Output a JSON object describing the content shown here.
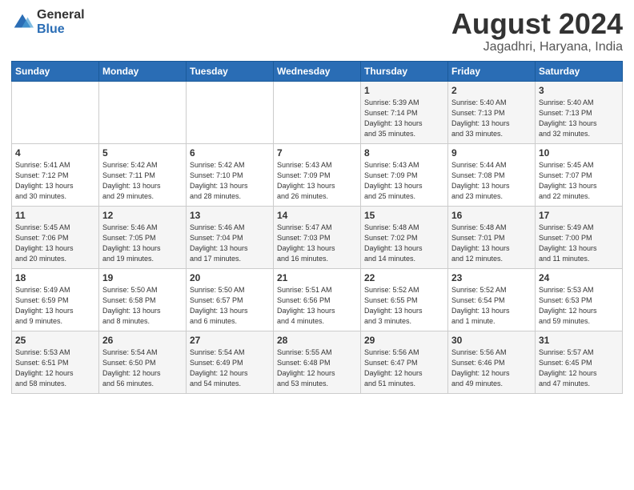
{
  "header": {
    "logo_general": "General",
    "logo_blue": "Blue",
    "month_year": "August 2024",
    "location": "Jagadhri, Haryana, India"
  },
  "days_of_week": [
    "Sunday",
    "Monday",
    "Tuesday",
    "Wednesday",
    "Thursday",
    "Friday",
    "Saturday"
  ],
  "weeks": [
    [
      {
        "day": "",
        "info": ""
      },
      {
        "day": "",
        "info": ""
      },
      {
        "day": "",
        "info": ""
      },
      {
        "day": "",
        "info": ""
      },
      {
        "day": "1",
        "info": "Sunrise: 5:39 AM\nSunset: 7:14 PM\nDaylight: 13 hours\nand 35 minutes."
      },
      {
        "day": "2",
        "info": "Sunrise: 5:40 AM\nSunset: 7:13 PM\nDaylight: 13 hours\nand 33 minutes."
      },
      {
        "day": "3",
        "info": "Sunrise: 5:40 AM\nSunset: 7:13 PM\nDaylight: 13 hours\nand 32 minutes."
      }
    ],
    [
      {
        "day": "4",
        "info": "Sunrise: 5:41 AM\nSunset: 7:12 PM\nDaylight: 13 hours\nand 30 minutes."
      },
      {
        "day": "5",
        "info": "Sunrise: 5:42 AM\nSunset: 7:11 PM\nDaylight: 13 hours\nand 29 minutes."
      },
      {
        "day": "6",
        "info": "Sunrise: 5:42 AM\nSunset: 7:10 PM\nDaylight: 13 hours\nand 28 minutes."
      },
      {
        "day": "7",
        "info": "Sunrise: 5:43 AM\nSunset: 7:09 PM\nDaylight: 13 hours\nand 26 minutes."
      },
      {
        "day": "8",
        "info": "Sunrise: 5:43 AM\nSunset: 7:09 PM\nDaylight: 13 hours\nand 25 minutes."
      },
      {
        "day": "9",
        "info": "Sunrise: 5:44 AM\nSunset: 7:08 PM\nDaylight: 13 hours\nand 23 minutes."
      },
      {
        "day": "10",
        "info": "Sunrise: 5:45 AM\nSunset: 7:07 PM\nDaylight: 13 hours\nand 22 minutes."
      }
    ],
    [
      {
        "day": "11",
        "info": "Sunrise: 5:45 AM\nSunset: 7:06 PM\nDaylight: 13 hours\nand 20 minutes."
      },
      {
        "day": "12",
        "info": "Sunrise: 5:46 AM\nSunset: 7:05 PM\nDaylight: 13 hours\nand 19 minutes."
      },
      {
        "day": "13",
        "info": "Sunrise: 5:46 AM\nSunset: 7:04 PM\nDaylight: 13 hours\nand 17 minutes."
      },
      {
        "day": "14",
        "info": "Sunrise: 5:47 AM\nSunset: 7:03 PM\nDaylight: 13 hours\nand 16 minutes."
      },
      {
        "day": "15",
        "info": "Sunrise: 5:48 AM\nSunset: 7:02 PM\nDaylight: 13 hours\nand 14 minutes."
      },
      {
        "day": "16",
        "info": "Sunrise: 5:48 AM\nSunset: 7:01 PM\nDaylight: 13 hours\nand 12 minutes."
      },
      {
        "day": "17",
        "info": "Sunrise: 5:49 AM\nSunset: 7:00 PM\nDaylight: 13 hours\nand 11 minutes."
      }
    ],
    [
      {
        "day": "18",
        "info": "Sunrise: 5:49 AM\nSunset: 6:59 PM\nDaylight: 13 hours\nand 9 minutes."
      },
      {
        "day": "19",
        "info": "Sunrise: 5:50 AM\nSunset: 6:58 PM\nDaylight: 13 hours\nand 8 minutes."
      },
      {
        "day": "20",
        "info": "Sunrise: 5:50 AM\nSunset: 6:57 PM\nDaylight: 13 hours\nand 6 minutes."
      },
      {
        "day": "21",
        "info": "Sunrise: 5:51 AM\nSunset: 6:56 PM\nDaylight: 13 hours\nand 4 minutes."
      },
      {
        "day": "22",
        "info": "Sunrise: 5:52 AM\nSunset: 6:55 PM\nDaylight: 13 hours\nand 3 minutes."
      },
      {
        "day": "23",
        "info": "Sunrise: 5:52 AM\nSunset: 6:54 PM\nDaylight: 13 hours\nand 1 minute."
      },
      {
        "day": "24",
        "info": "Sunrise: 5:53 AM\nSunset: 6:53 PM\nDaylight: 12 hours\nand 59 minutes."
      }
    ],
    [
      {
        "day": "25",
        "info": "Sunrise: 5:53 AM\nSunset: 6:51 PM\nDaylight: 12 hours\nand 58 minutes."
      },
      {
        "day": "26",
        "info": "Sunrise: 5:54 AM\nSunset: 6:50 PM\nDaylight: 12 hours\nand 56 minutes."
      },
      {
        "day": "27",
        "info": "Sunrise: 5:54 AM\nSunset: 6:49 PM\nDaylight: 12 hours\nand 54 minutes."
      },
      {
        "day": "28",
        "info": "Sunrise: 5:55 AM\nSunset: 6:48 PM\nDaylight: 12 hours\nand 53 minutes."
      },
      {
        "day": "29",
        "info": "Sunrise: 5:56 AM\nSunset: 6:47 PM\nDaylight: 12 hours\nand 51 minutes."
      },
      {
        "day": "30",
        "info": "Sunrise: 5:56 AM\nSunset: 6:46 PM\nDaylight: 12 hours\nand 49 minutes."
      },
      {
        "day": "31",
        "info": "Sunrise: 5:57 AM\nSunset: 6:45 PM\nDaylight: 12 hours\nand 47 minutes."
      }
    ]
  ]
}
